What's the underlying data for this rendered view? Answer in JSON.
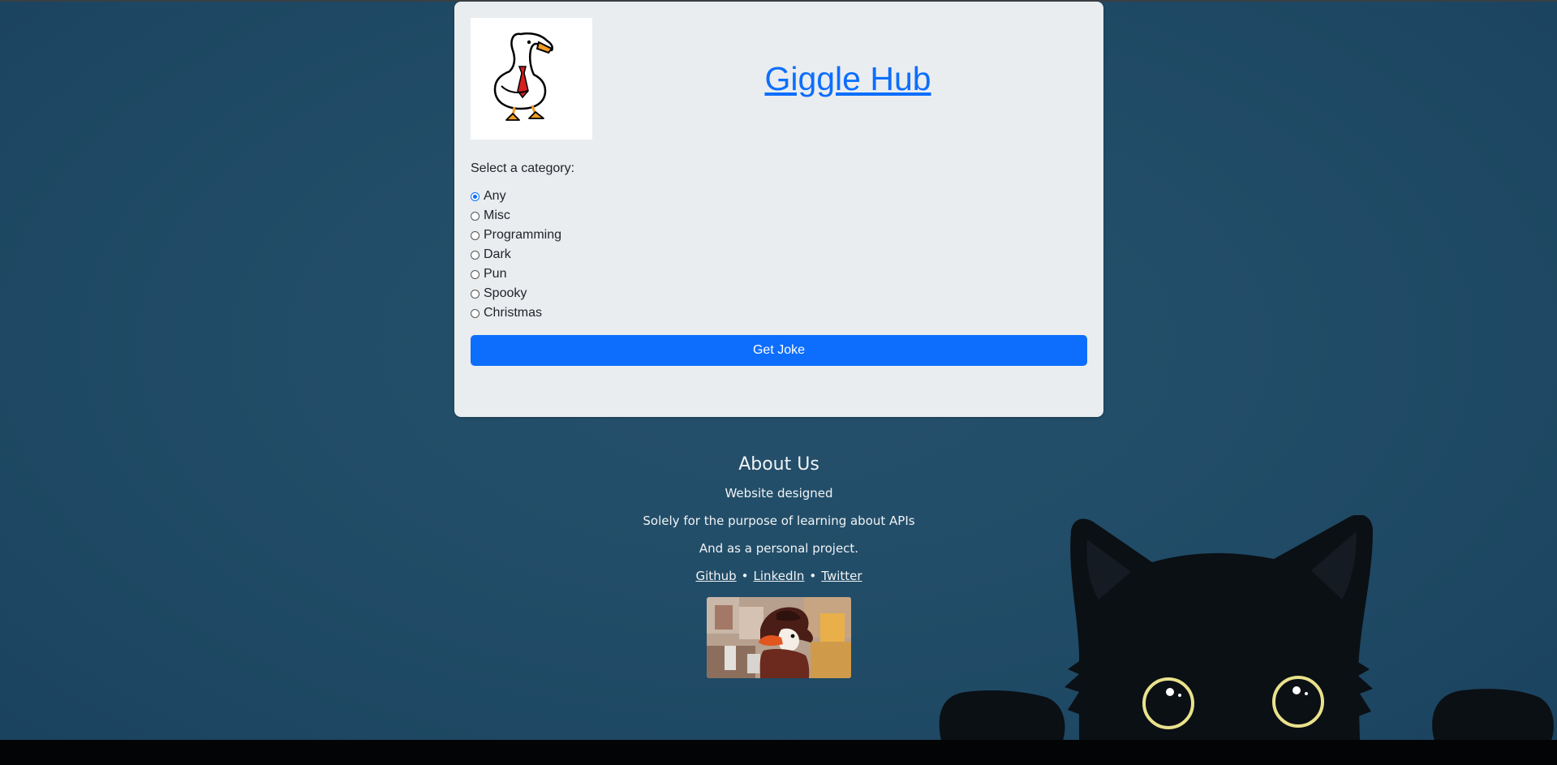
{
  "app": {
    "title": "Giggle Hub",
    "logo_icon": "goose-logo-icon"
  },
  "form": {
    "category_label": "Select a category:",
    "selected": "Any",
    "categories": [
      "Any",
      "Misc",
      "Programming",
      "Dark",
      "Pun",
      "Spooky",
      "Christmas"
    ],
    "submit_label": "Get Joke"
  },
  "about": {
    "heading": "About Us",
    "lines": [
      "Website designed",
      "Solely for the purpose of learning about APIs",
      "And as a personal project."
    ],
    "links": [
      "Github",
      "LinkedIn",
      "Twitter"
    ],
    "separator": "•",
    "image_icon": "goose-detective-illustration"
  },
  "colors": {
    "accent": "#0d6efd",
    "background": "#224d68",
    "card": "#e9edf0"
  }
}
